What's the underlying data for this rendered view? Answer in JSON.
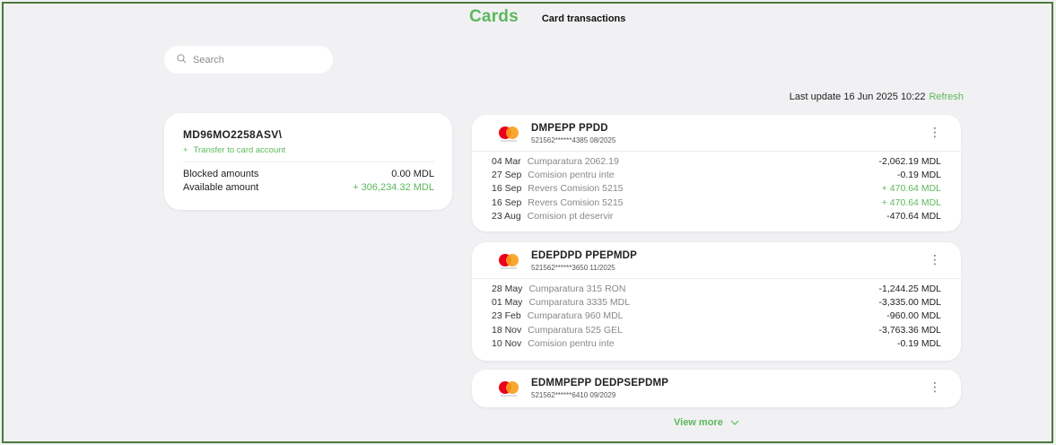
{
  "tabs": {
    "active": "Cards",
    "other": "Card transactions"
  },
  "search": {
    "placeholder": "Search"
  },
  "last_update": {
    "label": "Last update 16 Jun 2025 10:22",
    "refresh": "Refresh"
  },
  "account": {
    "id": "MD96MO2258ASV\\",
    "transfer": "Transfer to card account",
    "blocked_label": "Blocked amounts",
    "blocked_value": "0.00 MDL",
    "available_label": "Available amount",
    "available_value": "+ 306,234.32 MDL"
  },
  "cards": [
    {
      "name": "DMPEPP PPDD",
      "sub": "521562******4385 08/2025",
      "transactions": [
        {
          "date": "04 Mar",
          "desc": "Cumparatura 2062.19",
          "amount": "-2,062.19 MDL",
          "positive": false
        },
        {
          "date": "27 Sep",
          "desc": "Comision pentru inte",
          "amount": "-0.19 MDL",
          "positive": false
        },
        {
          "date": "16 Sep",
          "desc": "Revers Comision 5215",
          "amount": "+ 470.64 MDL",
          "positive": true
        },
        {
          "date": "16 Sep",
          "desc": "Revers Comision 5215",
          "amount": "+ 470.64 MDL",
          "positive": true
        },
        {
          "date": "23 Aug",
          "desc": "Comision pt deservir",
          "amount": "-470.64 MDL",
          "positive": false
        }
      ]
    },
    {
      "name": "EDEPDPD PPEPMDP",
      "sub": "521562******3650 11/2025",
      "transactions": [
        {
          "date": "28 May",
          "desc": "Cumparatura 315 RON",
          "amount": "-1,244.25 MDL",
          "positive": false
        },
        {
          "date": "01 May",
          "desc": "Cumparatura 3335 MDL",
          "amount": "-3,335.00 MDL",
          "positive": false
        },
        {
          "date": "23 Feb",
          "desc": "Cumparatura 960 MDL",
          "amount": "-960.00 MDL",
          "positive": false
        },
        {
          "date": "18 Nov",
          "desc": "Cumparatura 525 GEL",
          "amount": "-3,763.36 MDL",
          "positive": false
        },
        {
          "date": "10 Nov",
          "desc": "Comision pentru inte",
          "amount": "-0.19 MDL",
          "positive": false
        }
      ]
    },
    {
      "name": "EDMMPEPP DEDPSEPDMP",
      "sub": "521562******6410 09/2029",
      "transactions": []
    }
  ],
  "view_more": "View more",
  "icons": {
    "search": "search-icon",
    "plus": "plus-icon",
    "card_logo": "mastercard-logo",
    "menu": "kebab-menu-icon",
    "chevron": "chevron-down-icon"
  },
  "colors": {
    "accent": "#5cb85c",
    "mc_red": "#eb001b",
    "mc_orange": "#f79e1b"
  }
}
